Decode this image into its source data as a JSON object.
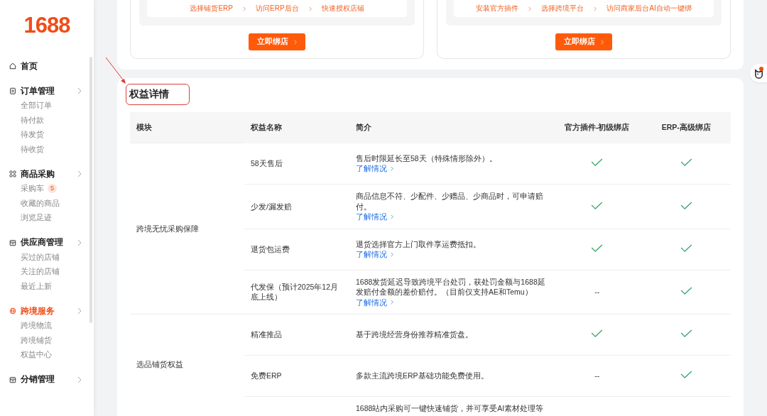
{
  "logo": "1688",
  "sidebar": {
    "groups": [
      {
        "title": "首页",
        "kind": "link",
        "active": false
      },
      {
        "title": "订单管理",
        "kind": "menu",
        "active": false,
        "items": [
          {
            "label": "全部订单"
          },
          {
            "label": "待付款"
          },
          {
            "label": "待发货"
          },
          {
            "label": "待收货"
          }
        ]
      },
      {
        "title": "商品采购",
        "kind": "menu",
        "active": false,
        "items": [
          {
            "label": "采购车",
            "badge": "5"
          },
          {
            "label": "收藏的商品"
          },
          {
            "label": "浏览足迹"
          }
        ]
      },
      {
        "title": "供应商管理",
        "kind": "menu",
        "active": false,
        "items": [
          {
            "label": "买过的店铺"
          },
          {
            "label": "关注的店铺"
          },
          {
            "label": "最近上新"
          }
        ]
      },
      {
        "title": "跨境服务",
        "kind": "menu",
        "active": true,
        "items": [
          {
            "label": "跨境物流"
          },
          {
            "label": "跨境铺货"
          },
          {
            "label": "权益中心"
          }
        ]
      },
      {
        "title": "分销管理",
        "kind": "menu",
        "active": false
      }
    ]
  },
  "bind_cards": [
    {
      "steps": [
        "选择铺货ERP",
        "访问ERP后台",
        "快速授权店铺"
      ],
      "button": "立即绑店"
    },
    {
      "steps": [
        "安装官方插件",
        "选择跨境平台",
        "访问商家后台AI自动一键绑"
      ],
      "button": "立即绑店"
    }
  ],
  "rights": {
    "title": "权益详情",
    "columns": [
      "模块",
      "权益名称",
      "简介",
      "官方插件-初级绑店",
      "ERP-高级绑店"
    ],
    "modules": [
      {
        "name": "跨境无忧采购保障",
        "rows": [
          {
            "name": "58天售后",
            "intro": "售后时限延长至58天（特殊情形除外）。",
            "link": "了解情况",
            "plugin": {
              "kind": "check"
            },
            "erp": {
              "kind": "check"
            }
          },
          {
            "name": "少发/漏发赔",
            "intro": "商品信息不符、少配件、少赠品、少商品时，可申请赔付。",
            "link": "了解情况",
            "plugin": {
              "kind": "check"
            },
            "erp": {
              "kind": "check"
            }
          },
          {
            "name": "退货包运费",
            "intro": "退货选择官方上门取件享运费抵扣。",
            "link": "了解情况",
            "plugin": {
              "kind": "check"
            },
            "erp": {
              "kind": "check"
            }
          },
          {
            "name": "代发保（预计2025年12月底上线）",
            "intro": "1688发货延迟导致跨境平台处罚，获处罚金额与1688延发赔付金额的差价赔付。（目前仅支持AE和Temu）",
            "link": "了解情况",
            "plugin": {
              "kind": "dash",
              "text": "--"
            },
            "erp": {
              "kind": "check"
            }
          }
        ]
      },
      {
        "name": "选品铺货权益",
        "rows": [
          {
            "name": "精准推品",
            "intro": "基于跨境经营身份推荐精准货盘。",
            "plugin": {
              "kind": "check"
            },
            "erp": {
              "kind": "check"
            }
          },
          {
            "name": "免费ERP",
            "intro": "多款主流跨境ERP基础功能免费使用。",
            "plugin": {
              "kind": "dash",
              "text": "--"
            },
            "erp": {
              "kind": "check"
            }
          },
          {
            "intro": "1688站内采购可一键快速铺货，并可享受AI素材处理等"
          }
        ]
      }
    ]
  }
}
